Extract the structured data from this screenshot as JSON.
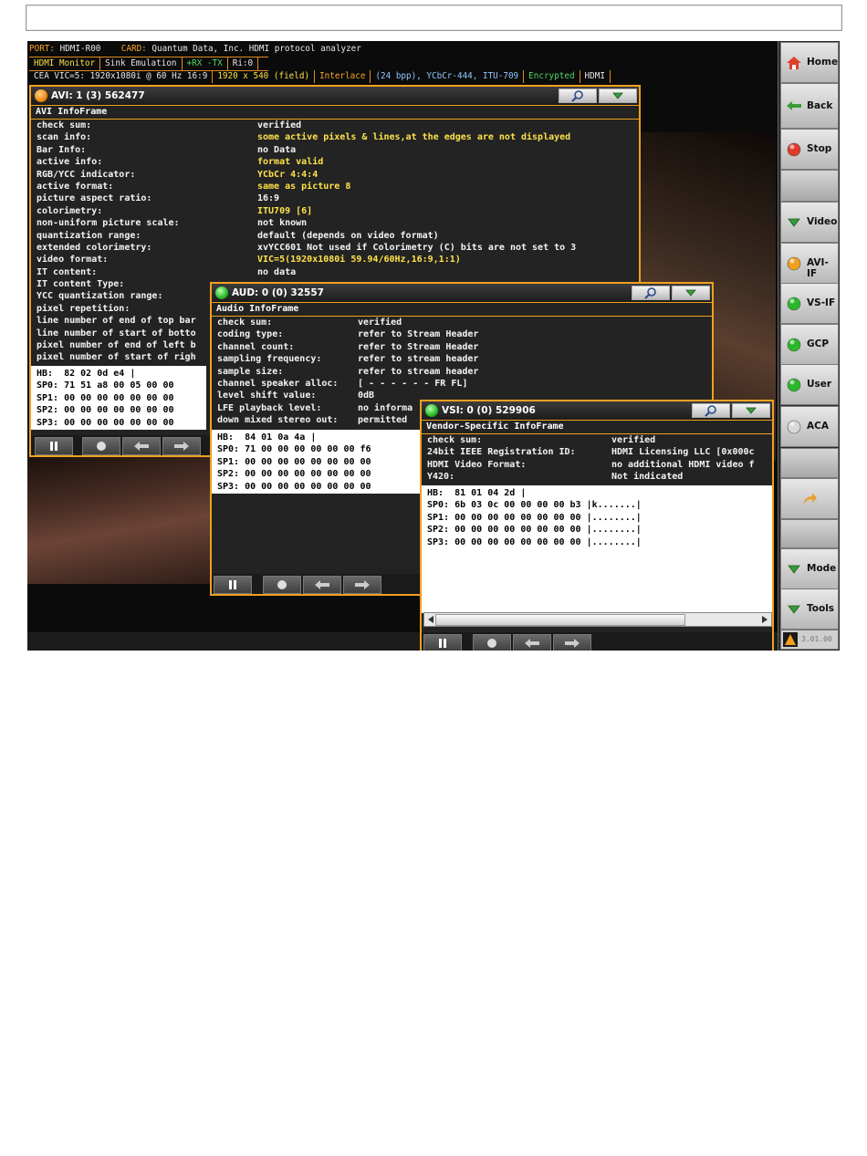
{
  "status": {
    "port_label": "PORT:",
    "port_value": "HDMI-R00",
    "card_label": "CARD:",
    "card_value": "Quantum Data, Inc. HDMI protocol analyzer",
    "mode_tabs": [
      "HDMI Monitor",
      "Sink Emulation",
      "+RX -TX",
      "Ri:0"
    ],
    "line3": [
      "CEA VIC=5: 1920x1080i @ 60 Hz 16:9",
      "1920 x 540 (field)",
      "Interlace",
      "(24 bpp), YCbCr-444, ITU-709",
      "Encrypted",
      "HDMI"
    ]
  },
  "avi": {
    "title": "AVI: 1 (3) 562477",
    "subtitle": "AVI InfoFrame",
    "fields": [
      {
        "k": "check sum:",
        "v": "verified",
        "hl": false
      },
      {
        "k": "scan info:",
        "v": "some active pixels & lines,at the edges are not displayed",
        "hl": true
      },
      {
        "k": "Bar Info:",
        "v": "no Data",
        "hl": false
      },
      {
        "k": "active info:",
        "v": "format valid",
        "hl": true
      },
      {
        "k": "RGB/YCC indicator:",
        "v": "YCbCr 4:4:4",
        "hl": true
      },
      {
        "k": "active format:",
        "v": "same as picture 8",
        "hl": true
      },
      {
        "k": "picture aspect ratio:",
        "v": "16:9",
        "hl": false
      },
      {
        "k": "colorimetry:",
        "v": "ITU709 [6]",
        "hl": true
      },
      {
        "k": "non-uniform picture scale:",
        "v": "not known",
        "hl": false
      },
      {
        "k": "quantization range:",
        "v": "default (depends on video format)",
        "hl": false
      },
      {
        "k": "extended colorimetry:",
        "v": "xvYCC601 Not used if Colorimetry (C) bits are not set to 3",
        "hl": false
      },
      {
        "k": "video format:",
        "v": "VIC=5(1920x1080i 59.94/60Hz,16:9,1:1)",
        "hl": true
      },
      {
        "k": "IT content:",
        "v": "no data",
        "hl": false
      },
      {
        "k": "IT content Type:",
        "v": "",
        "hl": false
      },
      {
        "k": "YCC quantization range:",
        "v": "",
        "hl": false
      },
      {
        "k": "pixel repetition:",
        "v": "",
        "hl": false
      },
      {
        "k": "line number of end of top bar",
        "v": "",
        "hl": false
      },
      {
        "k": "line number of start of botto",
        "v": "",
        "hl": false
      },
      {
        "k": "pixel number of end of left b",
        "v": "",
        "hl": false
      },
      {
        "k": "pixel number of start of righ",
        "v": "",
        "hl": false
      }
    ],
    "hex": [
      "HB:  82 02 0d e4 |",
      "SP0: 71 51 a8 00 05 00 00",
      "SP1: 00 00 00 00 00 00 00",
      "SP2: 00 00 00 00 00 00 00",
      "SP3: 00 00 00 00 00 00 00"
    ]
  },
  "aud": {
    "title": "AUD: 0 (0) 32557",
    "subtitle": "Audio InfoFrame",
    "fields": [
      {
        "k": "check sum:",
        "v": "verified"
      },
      {
        "k": "coding type:",
        "v": "refer to Stream Header"
      },
      {
        "k": "channel count:",
        "v": "refer to Stream Header"
      },
      {
        "k": "sampling frequency:",
        "v": "refer to stream header"
      },
      {
        "k": "sample size:",
        "v": "refer to stream header"
      },
      {
        "k": "channel speaker alloc:",
        "v": "[ -   -   -   -   -   -   FR FL]"
      },
      {
        "k": "level shift value:",
        "v": "0dB"
      },
      {
        "k": "LFE playback level:",
        "v": "no informa"
      },
      {
        "k": "down mixed stereo out:",
        "v": "permitted"
      }
    ],
    "hex": [
      "HB:  84 01 0a 4a |",
      "SP0: 71 00 00 00 00 00 00 f6",
      "SP1: 00 00 00 00 00 00 00 00",
      "SP2: 00 00 00 00 00 00 00 00",
      "SP3: 00 00 00 00 00 00 00 00"
    ]
  },
  "vsi": {
    "title": "VSI: 0 (0) 529906",
    "subtitle": "Vendor-Specific InfoFrame",
    "fields": [
      {
        "k": "check sum:",
        "v": "verified"
      },
      {
        "k": "24bit IEEE Registration ID:",
        "v": "HDMI Licensing LLC [0x000c"
      },
      {
        "k": "HDMI Video Format:",
        "v": "no additional HDMI video f"
      },
      {
        "k": "Y420:",
        "v": "Not indicated"
      }
    ],
    "hex": [
      "HB:  81 01 04 2d |",
      "SP0: 6b 03 0c 00 00 00 00 b3 |k.......|",
      "SP1: 00 00 00 00 00 00 00 00 |........|",
      "SP2: 00 00 00 00 00 00 00 00 |........|",
      "SP3: 00 00 00 00 00 00 00 00 |........|"
    ]
  },
  "sidebar": {
    "items": [
      {
        "label": "Home",
        "icon": "home-icon",
        "color": "#e0402a"
      },
      {
        "label": "Back",
        "icon": "back-arrow-icon",
        "color": "#3a9a3a"
      },
      {
        "label": "Stop",
        "icon": "stop-icon",
        "color": "#e03a2a"
      },
      {
        "label": "",
        "icon": "",
        "color": ""
      },
      {
        "label": "Video",
        "icon": "triangle-down-icon",
        "color": "#3a9a3a"
      },
      {
        "label": "AVI-IF",
        "icon": "orange-led-icon",
        "color": "#f0a020"
      },
      {
        "label": "VS-IF",
        "icon": "green-led-icon",
        "color": "#28b828"
      },
      {
        "label": "GCP",
        "icon": "green-led-icon",
        "color": "#28b828"
      },
      {
        "label": "User",
        "icon": "green-led-icon",
        "color": "#28b828"
      },
      {
        "label": "ACA",
        "icon": "gray-led-icon",
        "color": "#d8d8d8"
      },
      {
        "label": "",
        "icon": "",
        "color": ""
      },
      {
        "label": "",
        "icon": "share-arrow-icon",
        "color": "#e8a030"
      },
      {
        "label": "",
        "icon": "",
        "color": ""
      },
      {
        "label": "Mode",
        "icon": "triangle-down-icon",
        "color": "#3a9a3a"
      },
      {
        "label": "Tools",
        "icon": "triangle-down-icon",
        "color": "#3a9a3a"
      }
    ],
    "version": "3.01.00"
  }
}
